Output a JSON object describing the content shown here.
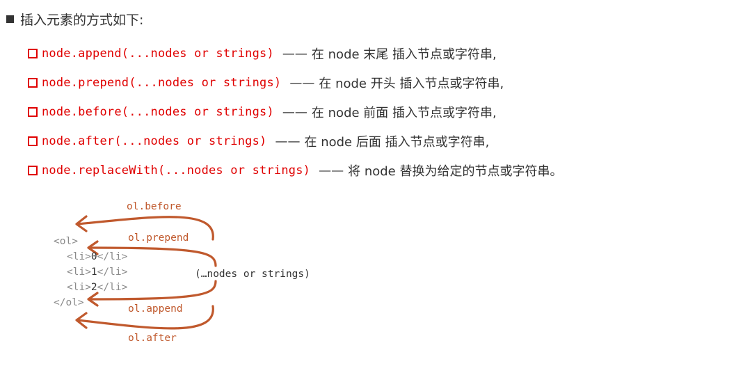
{
  "heading": "插入元素的方式如下:",
  "methods": [
    {
      "code": "node.append(...nodes or strings)",
      "dash": "——",
      "desc": "在 node 末尾 插入节点或字符串,"
    },
    {
      "code": "node.prepend(...nodes or strings)",
      "dash": "——",
      "desc": "在 node 开头 插入节点或字符串,"
    },
    {
      "code": "node.before(...nodes or strings)",
      "dash": "——",
      "desc": "在 node 前面 插入节点或字符串,"
    },
    {
      "code": "node.after(...nodes or strings)",
      "dash": "——",
      "desc": "在 node 后面 插入节点或字符串,"
    },
    {
      "code": "node.replaceWith(...nodes or strings)",
      "dash": "——",
      "desc": "将 node 替换为给定的节点或字符串。"
    }
  ],
  "diagram": {
    "labels": {
      "before": "ol.before",
      "prepend": "ol.prepend",
      "append": "ol.append",
      "after": "ol.after",
      "center": "(…nodes or strings)"
    },
    "code": {
      "ol_open": "<ol>",
      "li_open": "<li>",
      "li_close": "</li>",
      "items": [
        "0",
        "1",
        "2"
      ],
      "ol_close": "</ol>"
    },
    "accent_color": "#c0592d"
  }
}
